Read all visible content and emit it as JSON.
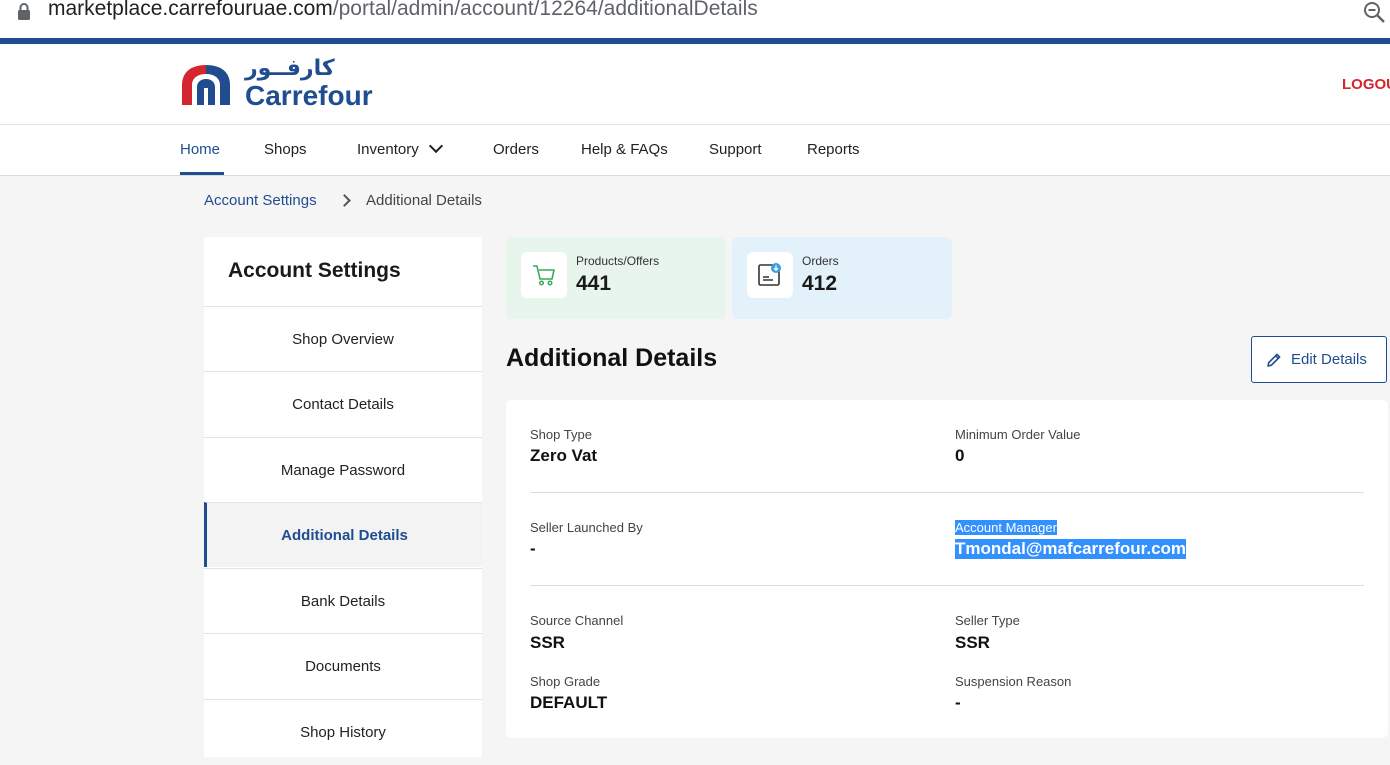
{
  "browser": {
    "url_host": "marketplace.carrefouruae.com",
    "url_path": "/portal/admin/account/12264/additionalDetails"
  },
  "header": {
    "logo_arabic": "كارفــور",
    "logo_text": "Carrefour",
    "logout_label": "LOGOU"
  },
  "nav": {
    "items": [
      {
        "label": "Home"
      },
      {
        "label": "Shops"
      },
      {
        "label": "Inventory"
      },
      {
        "label": "Orders"
      },
      {
        "label": "Help & FAQs"
      },
      {
        "label": "Support"
      },
      {
        "label": "Reports"
      }
    ]
  },
  "breadcrumb": {
    "parent": "Account Settings",
    "current": "Additional Details"
  },
  "sidebar": {
    "title": "Account Settings",
    "items": [
      {
        "label": "Shop Overview"
      },
      {
        "label": "Contact Details"
      },
      {
        "label": "Manage Password"
      },
      {
        "label": "Additional Details"
      },
      {
        "label": "Bank Details"
      },
      {
        "label": "Documents"
      },
      {
        "label": "Shop History"
      }
    ]
  },
  "stats": [
    {
      "label": "Products/Offers",
      "value": "441",
      "icon": "cart-icon"
    },
    {
      "label": "Orders",
      "value": "412",
      "icon": "orders-box-icon"
    }
  ],
  "section": {
    "title": "Additional Details",
    "edit_label": "Edit Details"
  },
  "details": {
    "shop_type": {
      "label": "Shop Type",
      "value": "Zero Vat"
    },
    "min_order_value": {
      "label": "Minimum Order Value",
      "value": "0"
    },
    "seller_launched_by": {
      "label": "Seller Launched By",
      "value": "-"
    },
    "account_manager": {
      "label": "Account Manager",
      "value": "Tmondal@mafcarrefour.com"
    },
    "source_channel": {
      "label": "Source Channel",
      "value": "SSR"
    },
    "seller_type": {
      "label": "Seller Type",
      "value": "SSR"
    },
    "shop_grade": {
      "label": "Shop Grade",
      "value": "DEFAULT"
    },
    "suspension_reason": {
      "label": "Suspension Reason",
      "value": "-"
    }
  },
  "colors": {
    "brand_blue": "#1f4d8f",
    "brand_red": "#d3262e",
    "selection": "#3390ff"
  }
}
